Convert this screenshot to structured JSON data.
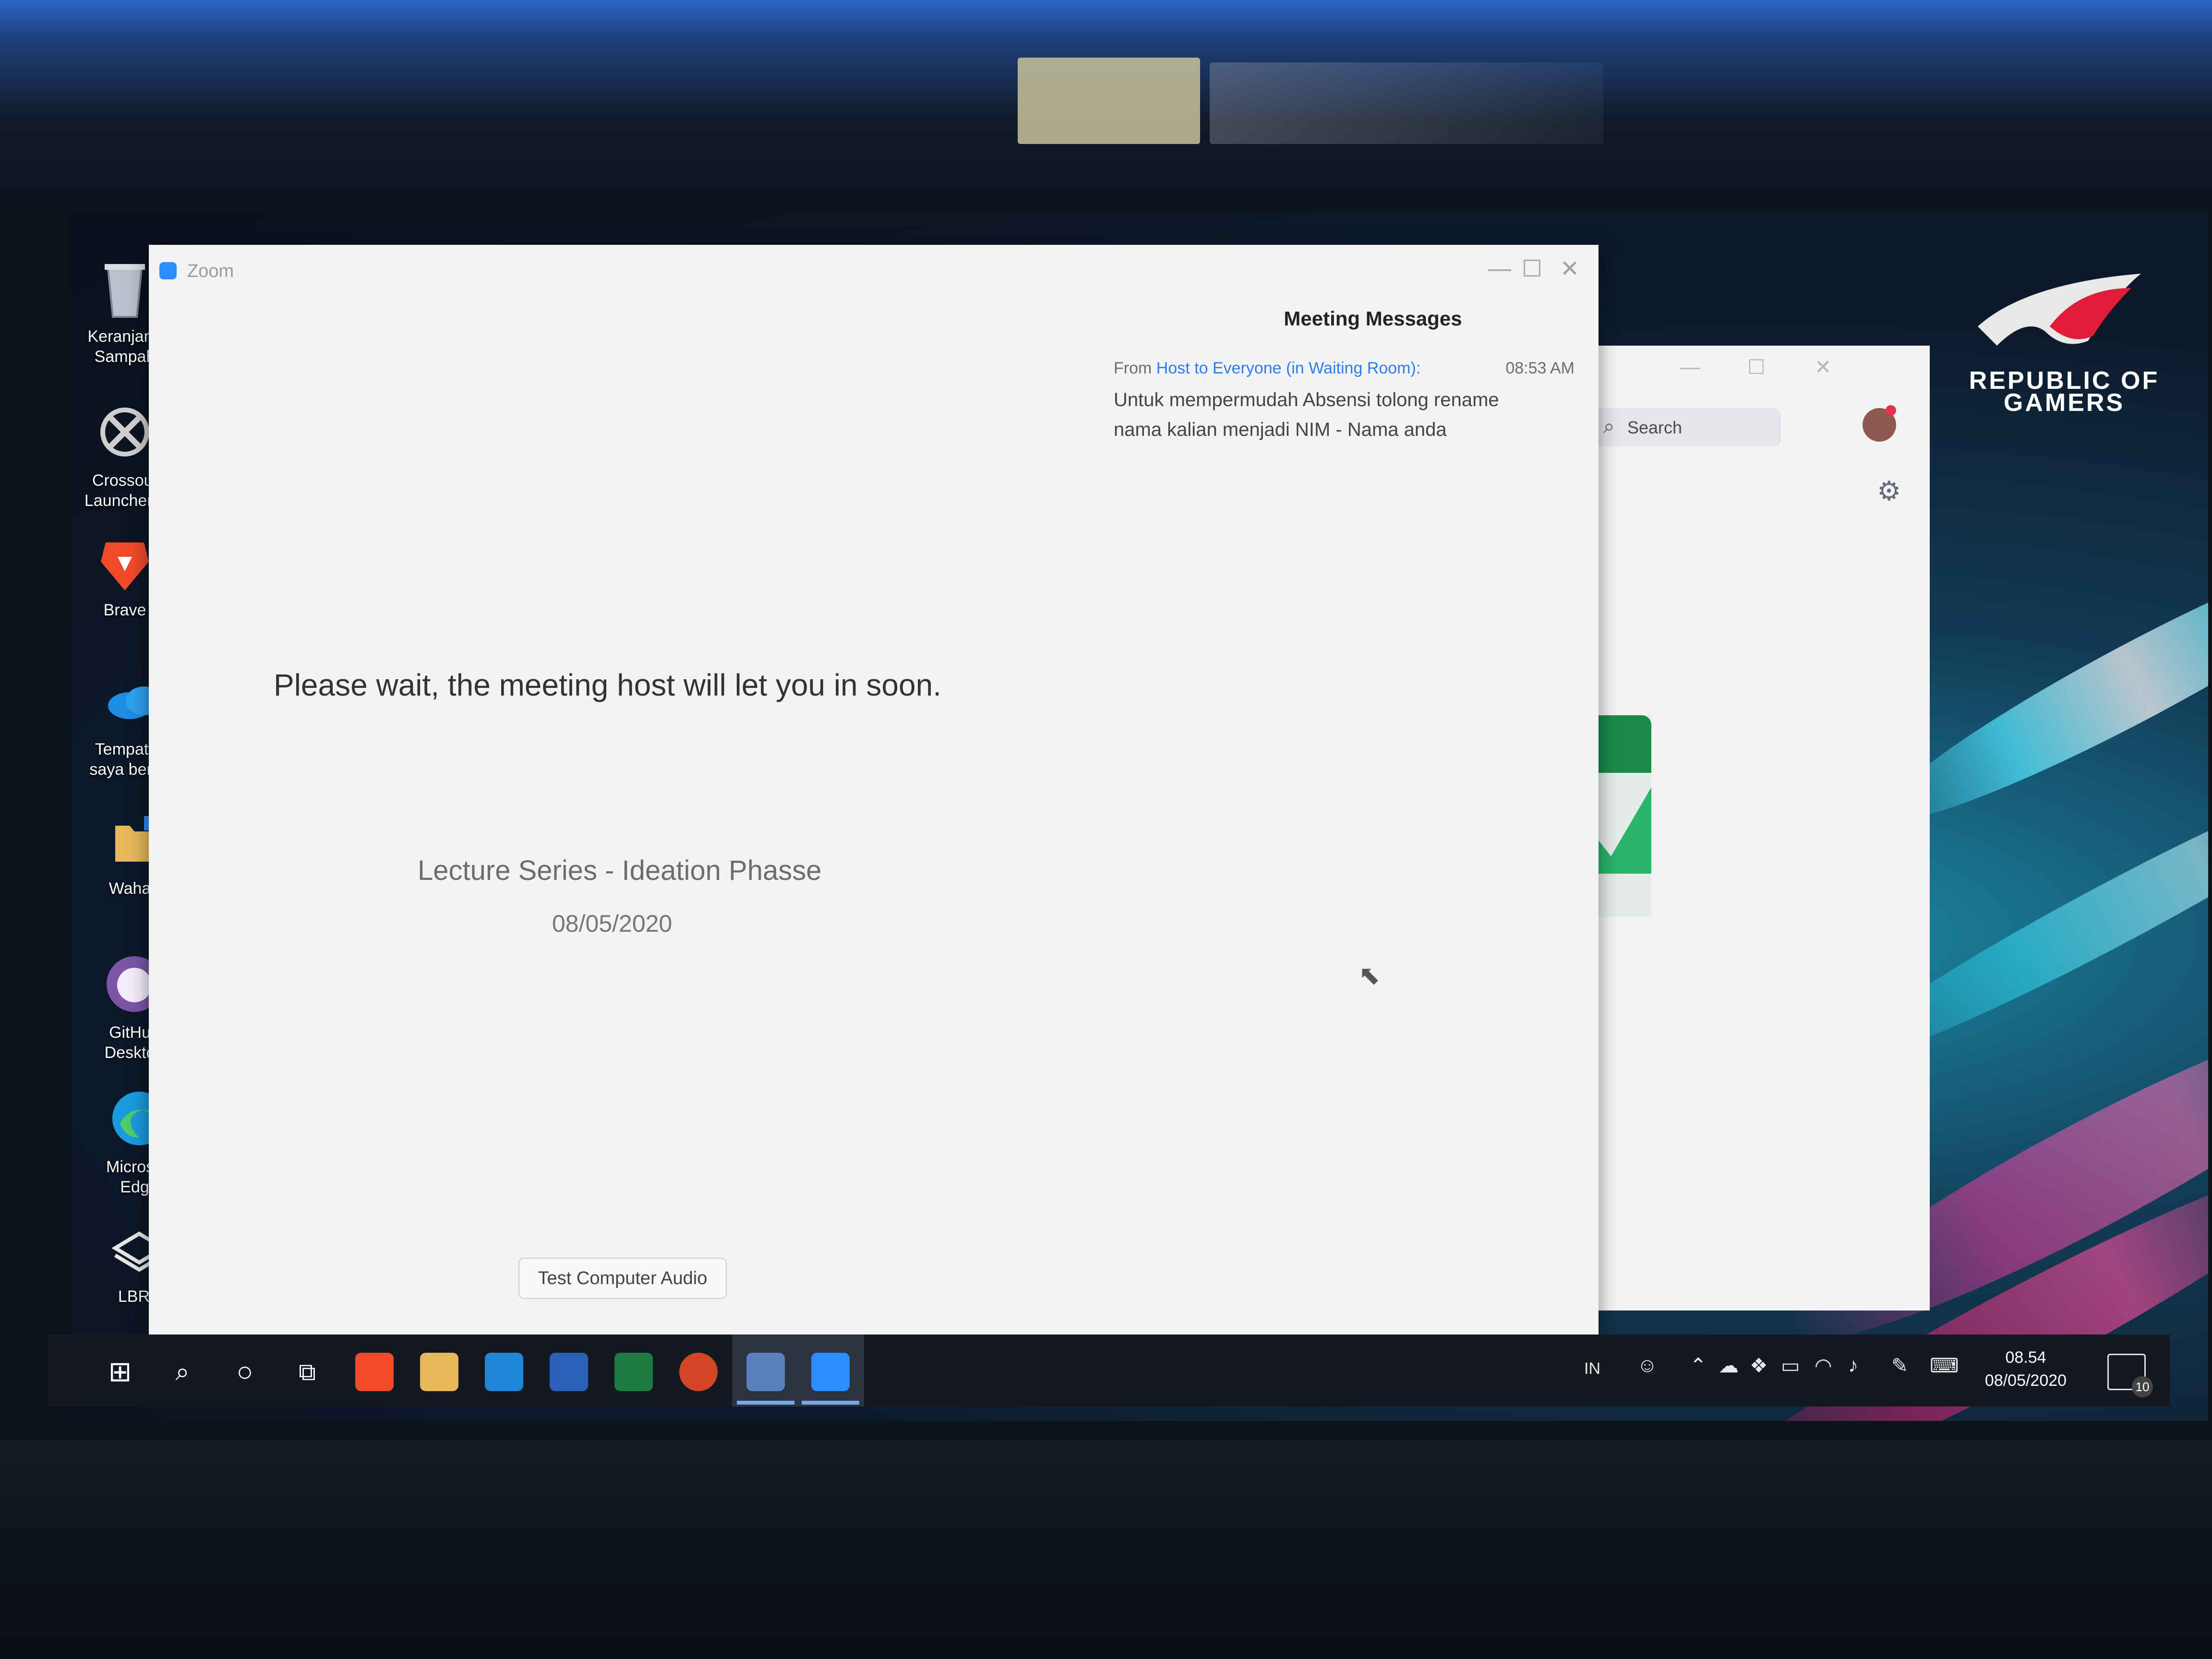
{
  "brand": {
    "rog_text": "REPUBLIC OF GAMERS"
  },
  "desktop_icons": [
    {
      "label": "Keranjang Sampah",
      "icon": "recycle-bin-icon"
    },
    {
      "label": "Crossout Launcher...",
      "icon": "crossout-icon"
    },
    {
      "label": "Brave",
      "icon": "brave-lion-icon"
    },
    {
      "label": "Tempat file saya berada",
      "icon": "onedrive-cloud-icon"
    },
    {
      "label": "Wahan",
      "icon": "folder-icon"
    },
    {
      "label": "GitHub Desktop",
      "icon": "github-octocat-icon"
    },
    {
      "label": "Microsoft Edge",
      "icon": "edge-icon"
    },
    {
      "label": "LBRY",
      "icon": "lbry-icon"
    }
  ],
  "zoom_window": {
    "title": "Zoom",
    "controls": {
      "minimize": "—",
      "maximize": "☐",
      "close": "✕"
    },
    "wait_message": "Please wait, the meeting host will let you in soon.",
    "meeting_name": "Lecture Series - Ideation Phasse",
    "meeting_date": "08/05/2020",
    "test_audio_label": "Test Computer Audio",
    "messages_panel": {
      "heading": "Meeting Messages",
      "messages": [
        {
          "from_prefix": "From",
          "sender": "Host to Everyone (in Waiting Room):",
          "time": "08:53 AM",
          "text": "Untuk mempermudah Absensi tolong rename nama kalian menjadi NIM - Nama anda"
        }
      ]
    }
  },
  "zoom_back_window": {
    "search_placeholder": "Search",
    "controls": {
      "minimize": "—",
      "maximize": "☐",
      "close": "✕"
    }
  },
  "taskbar": {
    "apps": [
      "start-icon",
      "search-icon",
      "cortana-icon",
      "task-view-icon",
      "brave-icon",
      "file-explorer-icon",
      "mail-icon",
      "word-icon",
      "excel-icon",
      "powerpoint-icon",
      "zoom-meetings-icon",
      "zoom-icon"
    ],
    "language": "IN",
    "clock_time": "08.54",
    "clock_date": "08/05/2020",
    "notification_count": "10"
  },
  "colors": {
    "zoom_blue": "#2d8cff",
    "link_blue": "#2d7cf0",
    "taskbar": "#141820"
  }
}
